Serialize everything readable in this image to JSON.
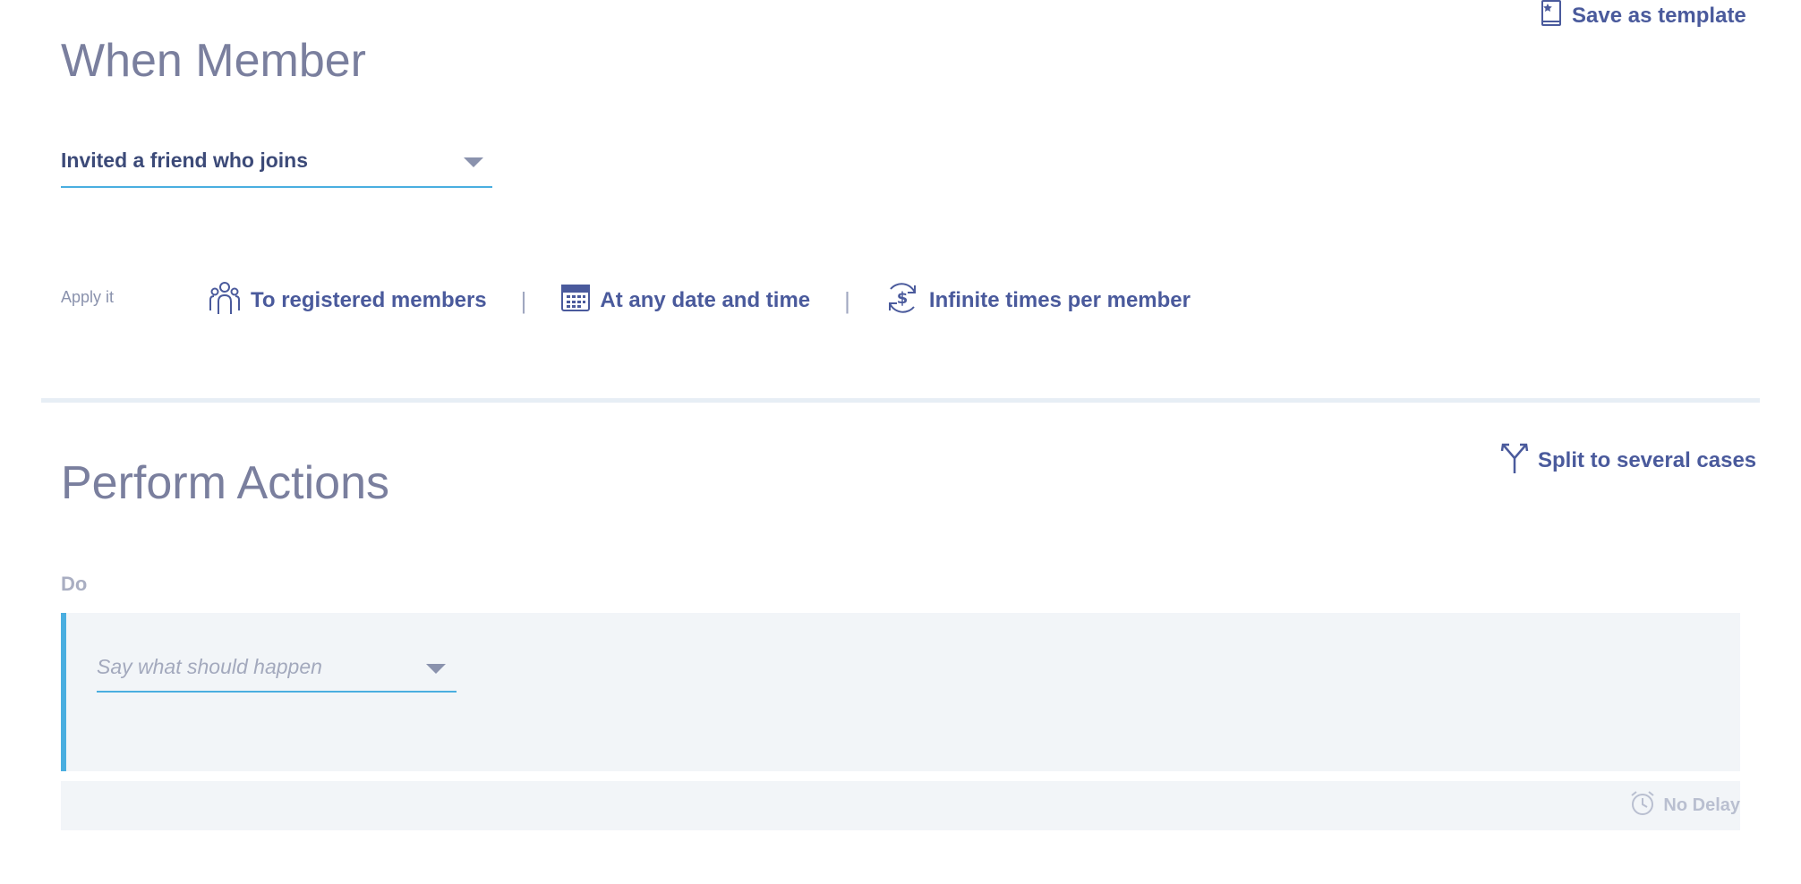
{
  "header": {
    "save_template_label": "Save as template"
  },
  "when_section": {
    "title": "When Member",
    "trigger_value": "Invited a friend who joins",
    "apply_label": "Apply it",
    "apply_options": [
      {
        "label": "To registered members",
        "icon": "members-icon"
      },
      {
        "label": "At any date and time",
        "icon": "calendar-icon"
      },
      {
        "label": "Infinite times per member",
        "icon": "refresh-dollar-icon"
      }
    ],
    "separator": "|"
  },
  "actions_section": {
    "title": "Perform Actions",
    "split_label": "Split to several cases",
    "do_label": "Do",
    "action_placeholder": "Say what should happen",
    "delay_label": "No Delay"
  },
  "colors": {
    "accent": "#4aaee0",
    "link": "#4a5a9c",
    "title": "#7a7f9e",
    "panel": "#f2f5f8"
  }
}
